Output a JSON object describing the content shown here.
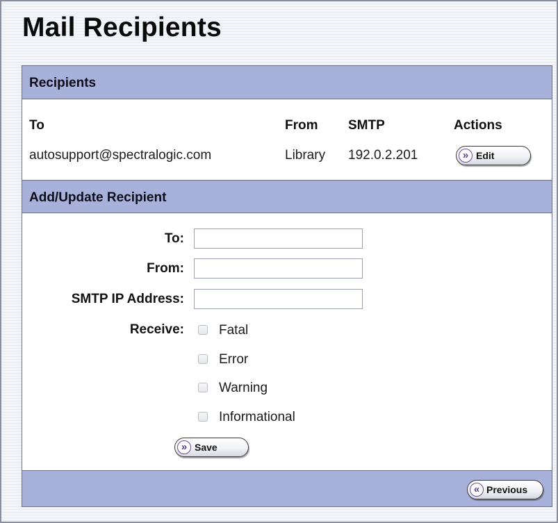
{
  "page": {
    "title": "Mail Recipients"
  },
  "recipients": {
    "section_title": "Recipients",
    "columns": {
      "to": "To",
      "from": "From",
      "smtp": "SMTP",
      "actions": "Actions"
    },
    "rows": [
      {
        "to": "autosupport@spectralogic.com",
        "from": "Library",
        "smtp": "192.0.2.201",
        "action_label": "Edit",
        "action_icon": "double-chevron-right-icon"
      }
    ]
  },
  "add_update": {
    "section_title": "Add/Update Recipient",
    "fields": {
      "to": {
        "label": "To:",
        "value": ""
      },
      "from": {
        "label": "From:",
        "value": ""
      },
      "smtp": {
        "label": "SMTP IP Address:",
        "value": ""
      }
    },
    "receive": {
      "label": "Receive:",
      "options": [
        {
          "label": "Fatal",
          "checked": false
        },
        {
          "label": "Error",
          "checked": false
        },
        {
          "label": "Warning",
          "checked": false
        },
        {
          "label": "Informational",
          "checked": false
        }
      ]
    },
    "save_label": "Save",
    "save_icon": "double-chevron-right-icon"
  },
  "footer": {
    "previous_label": "Previous",
    "previous_icon": "double-chevron-left-icon"
  },
  "colors": {
    "section_bar": "#a8b1d9",
    "border": "#6c7087",
    "button_glyph": "#5a3a8a"
  }
}
